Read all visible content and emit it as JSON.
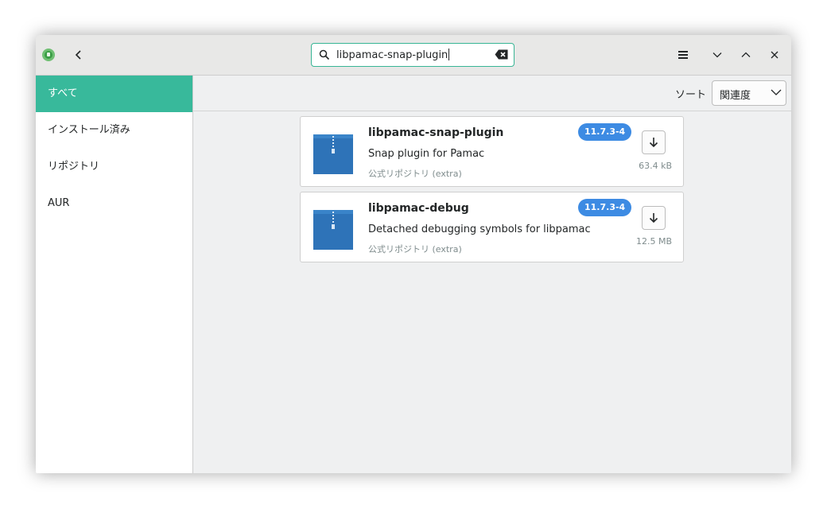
{
  "header": {
    "search_value": "libpamac-snap-plugin"
  },
  "sidebar": {
    "items": [
      {
        "label": "すべて"
      },
      {
        "label": "インストール済み"
      },
      {
        "label": "リポジトリ"
      },
      {
        "label": "AUR"
      }
    ]
  },
  "toolbar": {
    "sort_label": "ソート",
    "sort_value": "関連度"
  },
  "packages": [
    {
      "name": "libpamac-snap-plugin",
      "description": "Snap plugin for Pamac",
      "repository": "公式リポジトリ (extra)",
      "version": "11.7.3-4",
      "size": "63.4 kB"
    },
    {
      "name": "libpamac-debug",
      "description": "Detached debugging symbols for libpamac",
      "repository": "公式リポジトリ (extra)",
      "version": "11.7.3-4",
      "size": "12.5 MB"
    }
  ],
  "colors": {
    "accent": "#38b99b",
    "version_badge": "#3d8be3",
    "package_icon": "#2e73b8"
  },
  "icons": {
    "app": "pamac-app-icon",
    "back": "back-arrow-icon",
    "search": "search-icon",
    "clear": "clear-input-icon",
    "menu": "hamburger-menu-icon",
    "minimize": "minimize-icon",
    "maximize": "maximize-icon",
    "close": "close-icon",
    "sort_dropdown": "chevron-down-icon",
    "package": "archive-package-icon",
    "install": "download-arrow-icon"
  }
}
